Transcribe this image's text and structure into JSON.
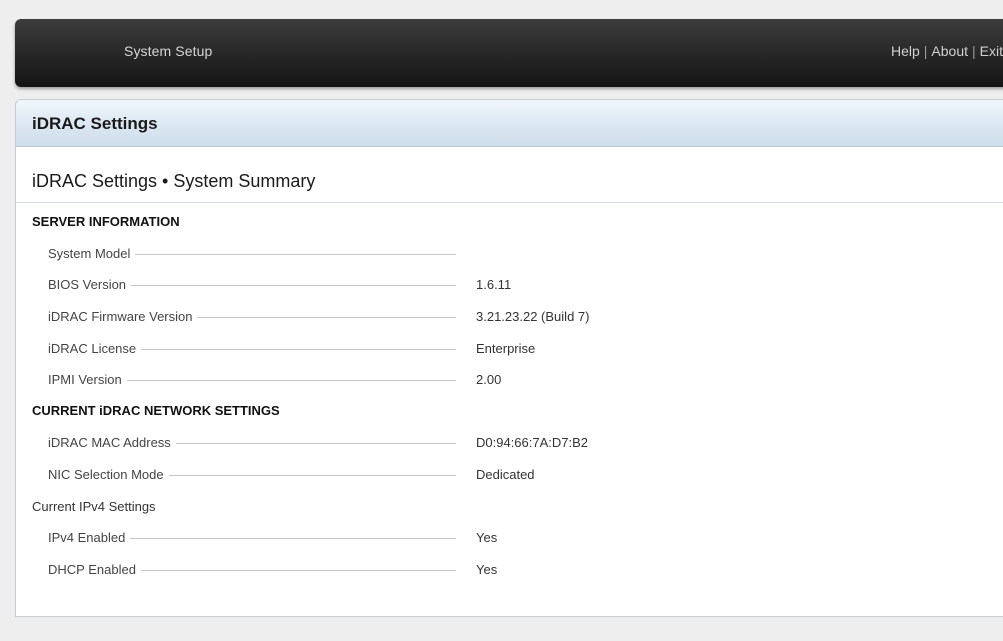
{
  "header": {
    "title": "System Setup",
    "nav": {
      "help": "Help",
      "about": "About",
      "exit": "Exit",
      "separator": "|"
    }
  },
  "panel": {
    "title": "iDRAC Settings",
    "section_title": "iDRAC Settings • System Summary"
  },
  "server_information": {
    "heading": "SERVER INFORMATION",
    "rows": [
      {
        "label": "System Model",
        "value": ""
      },
      {
        "label": "BIOS Version",
        "value": "1.6.11"
      },
      {
        "label": "iDRAC Firmware Version",
        "value": "3.21.23.22 (Build 7)"
      },
      {
        "label": "iDRAC License",
        "value": "Enterprise"
      },
      {
        "label": "IPMI Version",
        "value": "2.00"
      }
    ]
  },
  "network_settings": {
    "heading": "CURRENT iDRAC NETWORK SETTINGS",
    "rows": [
      {
        "label": "iDRAC MAC Address",
        "value": "D0:94:66:7A:D7:B2"
      },
      {
        "label": "NIC Selection Mode",
        "value": "Dedicated"
      }
    ]
  },
  "ipv4_settings": {
    "heading": "Current IPv4 Settings",
    "rows": [
      {
        "label": "IPv4 Enabled",
        "value": "Yes"
      },
      {
        "label": "DHCP Enabled",
        "value": "Yes"
      }
    ]
  }
}
